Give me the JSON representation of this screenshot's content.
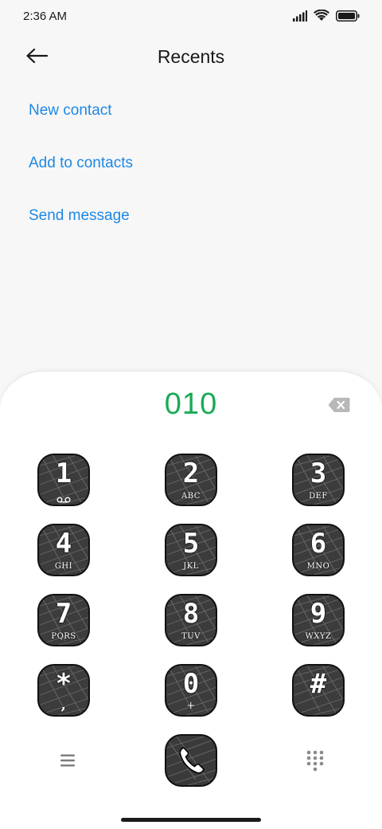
{
  "status_bar": {
    "time": "2:36 AM",
    "icons": [
      "signal-icon",
      "wifi-icon",
      "battery-icon"
    ]
  },
  "header": {
    "title": "Recents",
    "back_icon": "arrow-left-icon"
  },
  "actions": {
    "new_contact": "New contact",
    "add_to_contacts": "Add to contacts",
    "send_message": "Send message"
  },
  "dialpad": {
    "number": "010",
    "backspace_icon": "backspace-icon",
    "keys": [
      {
        "digit": "1",
        "letters": "",
        "extra_icon": "voicemail-icon"
      },
      {
        "digit": "2",
        "letters": "ABC"
      },
      {
        "digit": "3",
        "letters": "DEF"
      },
      {
        "digit": "4",
        "letters": "GHI"
      },
      {
        "digit": "5",
        "letters": "JKL"
      },
      {
        "digit": "6",
        "letters": "MNO"
      },
      {
        "digit": "7",
        "letters": "PQRS"
      },
      {
        "digit": "8",
        "letters": "TUV"
      },
      {
        "digit": "9",
        "letters": "WXYZ"
      },
      {
        "digit": "*",
        "letters": ","
      },
      {
        "digit": "0",
        "letters": "+"
      },
      {
        "digit": "#",
        "letters": ""
      }
    ]
  },
  "bottom_bar": {
    "menu_icon": "menu-icon",
    "call_icon": "phone-icon",
    "keypad_icon": "keypad-icon"
  },
  "colors": {
    "link": "#1e88e5",
    "dialed_number": "#1aaa55",
    "background": "#f7f7f7",
    "panel": "#ffffff"
  }
}
